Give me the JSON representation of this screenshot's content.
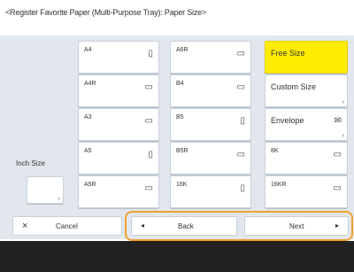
{
  "header": {
    "title": "<Register Favorite Paper (Multi-Purpose Tray): Paper Size>"
  },
  "inch_size": {
    "label": "Inch Size"
  },
  "grid": {
    "col1": [
      {
        "label": "A4",
        "icon": "portrait-paper-icon"
      },
      {
        "label": "A4R",
        "icon": "landscape-paper-icon"
      },
      {
        "label": "A3",
        "icon": "landscape-paper-icon"
      },
      {
        "label": "A5",
        "icon": "portrait-paper-icon"
      },
      {
        "label": "A5R",
        "icon": "landscape-paper-icon"
      }
    ],
    "col2": [
      {
        "label": "A6R",
        "icon": "landscape-paper-icon"
      },
      {
        "label": "B4",
        "icon": "landscape-paper-icon"
      },
      {
        "label": "B5",
        "icon": "portrait-paper-icon"
      },
      {
        "label": "B5R",
        "icon": "landscape-paper-icon"
      },
      {
        "label": "16K",
        "icon": "portrait-paper-icon"
      }
    ],
    "col3": [
      {
        "label": "Free Size",
        "selected": true
      },
      {
        "label": "Custom Size",
        "has_submenu": true
      },
      {
        "label": "Envelope",
        "icon": "envelope-icon",
        "has_submenu": true
      },
      {
        "label": "8K",
        "icon": "landscape-paper-icon"
      },
      {
        "label": "16KR",
        "icon": "landscape-paper-icon"
      }
    ]
  },
  "buttons": {
    "cancel": "Cancel",
    "back": "Back",
    "next": "Next"
  },
  "colors": {
    "selected": "#ffec00",
    "highlight": "#f0a030",
    "panel": "#e2e7ee"
  }
}
